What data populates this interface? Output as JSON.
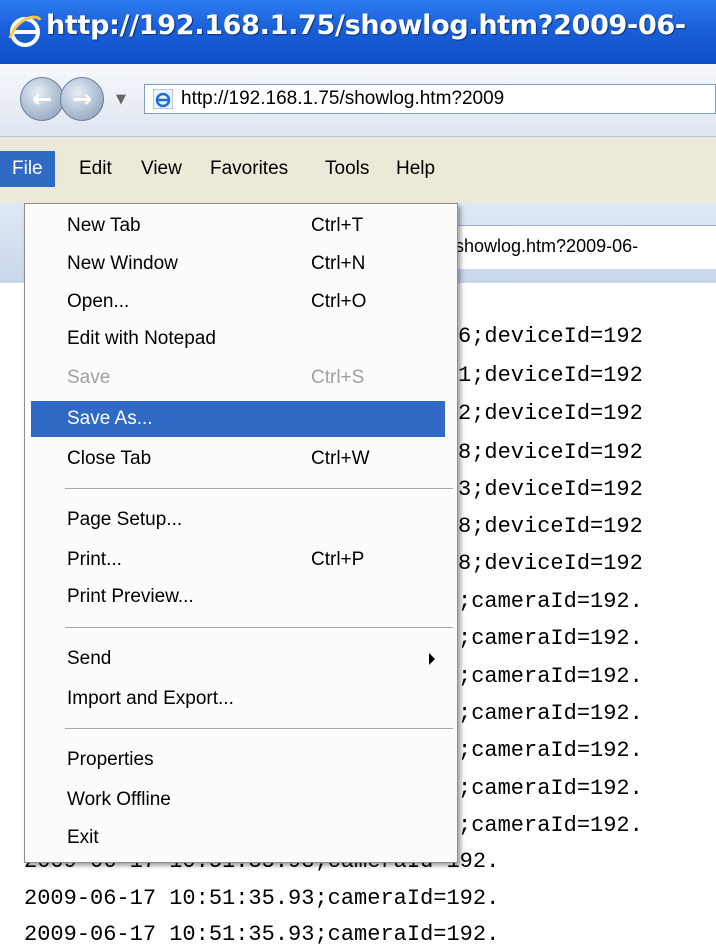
{
  "window": {
    "title": "http://192.168.1.75/showlog.htm?2009-06-"
  },
  "address": {
    "url": "http://192.168.1.75/showlog.htm?2009"
  },
  "menubar": [
    "File",
    "Edit",
    "View",
    "Favorites",
    "Tools",
    "Help"
  ],
  "tab": {
    "title": "showlog.htm?2009-06-"
  },
  "file_menu": {
    "items": [
      {
        "label": "New Tab",
        "shortcut": "Ctrl+T"
      },
      {
        "label": "New Window",
        "shortcut": "Ctrl+N"
      },
      {
        "label": "Open...",
        "shortcut": "Ctrl+O"
      },
      {
        "label": "Edit with Notepad",
        "shortcut": ""
      },
      {
        "label": "Save",
        "shortcut": "Ctrl+S"
      },
      {
        "label": "Save As...",
        "shortcut": ""
      },
      {
        "label": "Close Tab",
        "shortcut": "Ctrl+W"
      },
      {
        "label": "Page Setup...",
        "shortcut": ""
      },
      {
        "label": "Print...",
        "shortcut": "Ctrl+P"
      },
      {
        "label": "Print Preview...",
        "shortcut": ""
      },
      {
        "label": "Send",
        "shortcut": ""
      },
      {
        "label": "Import and Export...",
        "shortcut": ""
      },
      {
        "label": "Properties",
        "shortcut": ""
      },
      {
        "label": "Work Offline",
        "shortcut": ""
      },
      {
        "label": "Exit",
        "shortcut": ""
      }
    ]
  },
  "log_lines": [
    "6;deviceId=192",
    "1;deviceId=192",
    "2;deviceId=192",
    "8;deviceId=192",
    "3;deviceId=192",
    "8;deviceId=192",
    "8;deviceId=192",
    ";cameraId=192.",
    ";cameraId=192.",
    ";cameraId=192.",
    ";cameraId=192.",
    ";cameraId=192.",
    ";cameraId=192.",
    ";cameraId=192.",
    "2009-06-17 10:51:35.93;cameraId=192.",
    "2009-06-17 10:51:35.93;cameraId=192.",
    "2009-06-17 10:51:35.93;cameraId=192."
  ],
  "colors": {
    "titlebar": "#1a5fd8",
    "highlight": "#316ac5",
    "menubar": "#ece9d8"
  }
}
